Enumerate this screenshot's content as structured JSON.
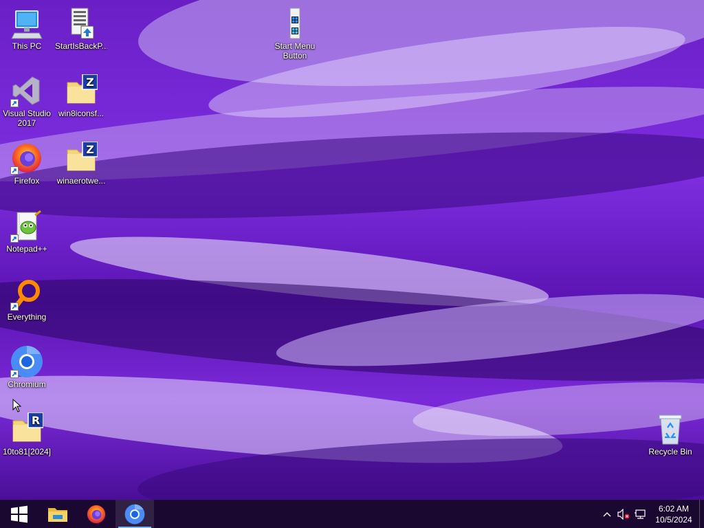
{
  "desktop": {
    "icons": [
      {
        "label": "This PC"
      },
      {
        "label": "StartIsBackP..."
      },
      {
        "label": "Start Menu Button"
      },
      {
        "label": "Visual Studio 2017"
      },
      {
        "label": "win8iconsf..."
      },
      {
        "label": "Firefox"
      },
      {
        "label": "winaerotwe..."
      },
      {
        "label": "Notepad++"
      },
      {
        "label": "Everything"
      },
      {
        "label": "Chromium"
      },
      {
        "label": "10to81[2024]"
      },
      {
        "label": "Recycle Bin"
      }
    ]
  },
  "taskbar": {
    "pinned": [
      {
        "icon": "windows-start-icon"
      },
      {
        "icon": "file-explorer-icon"
      },
      {
        "icon": "firefox-icon"
      },
      {
        "icon": "chromium-icon"
      }
    ],
    "clock": {
      "time": "6:02 AM",
      "date": "10/5/2024"
    }
  },
  "colors": {
    "accent": "#76b9ed",
    "taskbar": "#1a0830",
    "wallpaper": "#6a1fc6"
  }
}
